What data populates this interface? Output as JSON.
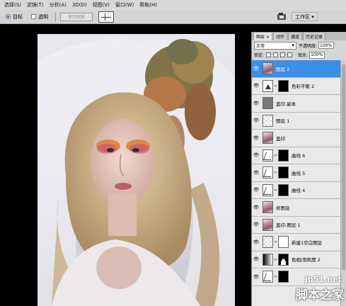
{
  "menu": [
    "选择(S)",
    "滤镜(T)",
    "分析(A)",
    "3D(D)",
    "视图(V)",
    "窗口(W)",
    "帮助(H)"
  ],
  "options": {
    "target_label": "目标",
    "transparent_label": "透明",
    "use_pattern_label": "使用图案"
  },
  "workspace_label": "工作区 ▾",
  "panel": {
    "tabs": [
      "图层 ×",
      "动作",
      "通道",
      "历史记录"
    ],
    "blend_mode": "正常",
    "opacity_label": "不透明度:",
    "opacity_value": "100%",
    "lock_label": "锁定:",
    "fill_label": "填充:",
    "fill_value": "100%"
  },
  "layers": [
    {
      "name": "图层 2",
      "thumb": "photo-t",
      "mask": null,
      "selected": true
    },
    {
      "name": "色彩平衡 2",
      "thumb": "balance",
      "mask": "black",
      "selected": false
    },
    {
      "name": "盖印 副本",
      "thumb": "grey",
      "mask": null,
      "selected": false
    },
    {
      "name": "图层 1",
      "thumb": "checker",
      "mask": null,
      "selected": false
    },
    {
      "name": "盖印",
      "thumb": "photo-t",
      "mask": null,
      "selected": false
    },
    {
      "name": "曲线 6",
      "thumb": "curve",
      "mask": "black",
      "selected": false
    },
    {
      "name": "曲线 5",
      "thumb": "curve",
      "mask": "black",
      "selected": false
    },
    {
      "name": "曲线 4",
      "thumb": "curve",
      "mask": "black",
      "selected": false
    },
    {
      "name": "修图底",
      "thumb": "photo-t",
      "mask": null,
      "selected": false
    },
    {
      "name": "盖印-图层 1",
      "thumb": "photo-t",
      "mask": null,
      "selected": false
    },
    {
      "name": "新建1空白图层",
      "thumb": "checker",
      "mask": "white",
      "selected": false
    },
    {
      "name": "色相/饱和度 2",
      "thumb": "gradient",
      "mask": "hill",
      "selected": false
    },
    {
      "name": "",
      "thumb": "curve",
      "mask": "black",
      "selected": false
    }
  ],
  "watermark": {
    "site": "jb51.net",
    "name": "脚本之家"
  }
}
